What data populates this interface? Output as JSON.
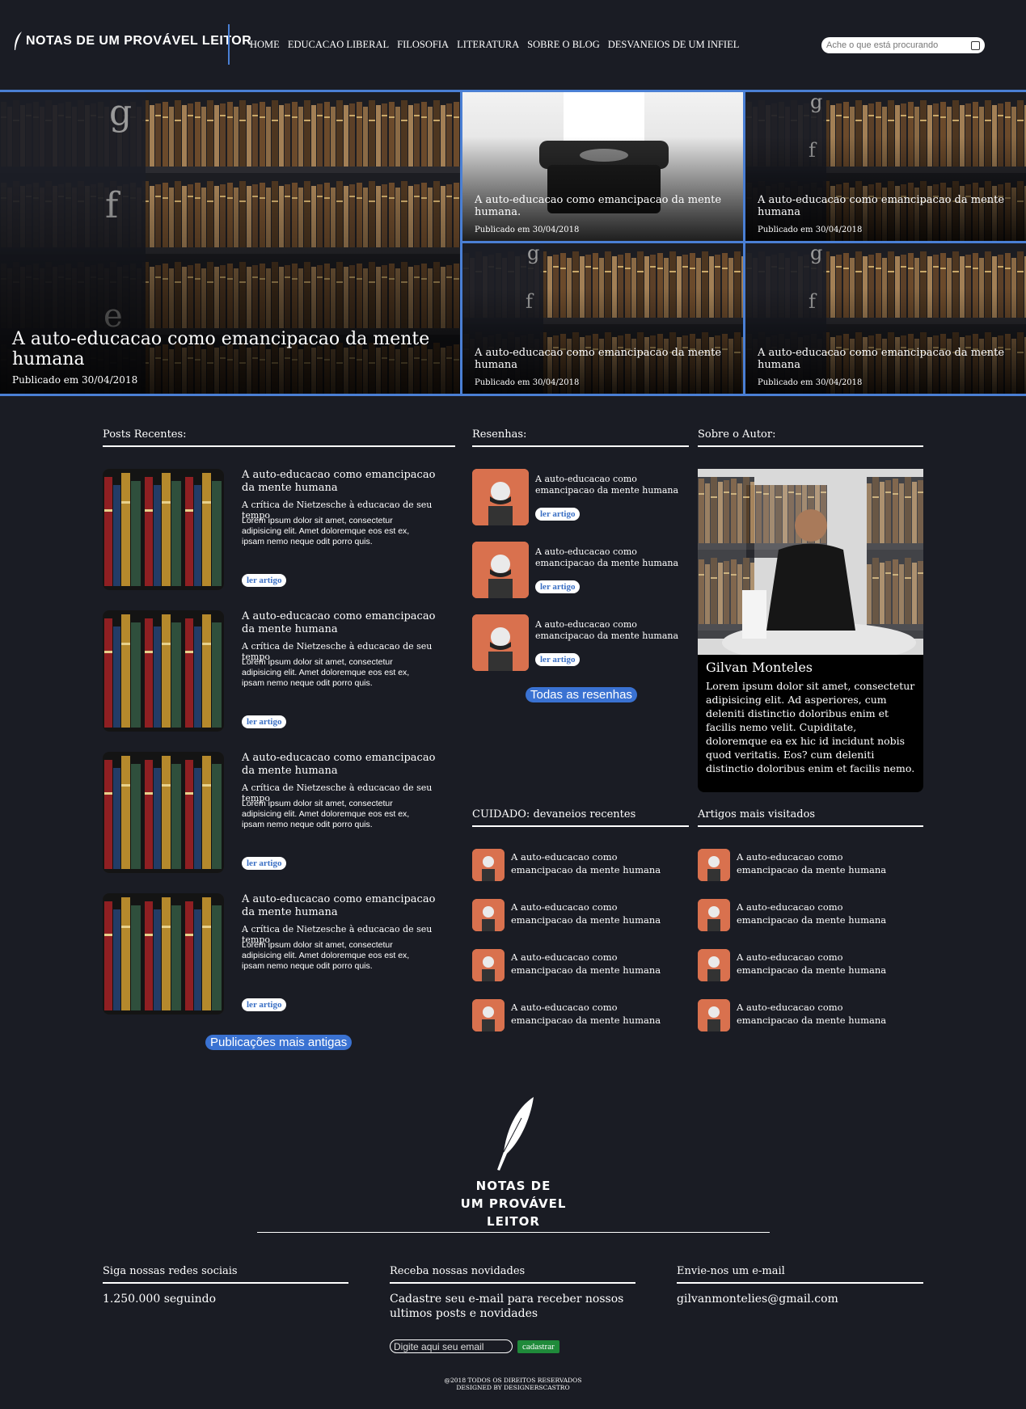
{
  "brand": {
    "logo_text": "NOTAS DE UM PROVÁVEL LEITOR"
  },
  "nav": [
    "HOME",
    "EDUCACAO LIBERAL",
    "FILOSOFIA",
    "LITERATURA",
    "SOBRE O BLOG",
    "DESVANEIOS DE UM INFIEL"
  ],
  "search": {
    "placeholder": "Ache o que está procurando"
  },
  "hero": {
    "main": {
      "title": "A auto-educacao como emancipacao da mente humana",
      "date": "Publicado em 30/04/2018"
    },
    "tiles": [
      {
        "title": "A auto-educacao como emancipacao da mente humana.",
        "date": "Publicado em 30/04/2018"
      },
      {
        "title": "A auto-educacao como emancipacao da mente humana",
        "date": "Publicado em 30/04/2018"
      },
      {
        "title": "A auto-educacao como emancipacao da mente humana",
        "date": "Publicado em 30/04/2018"
      },
      {
        "title": "A auto-educacao como emancipacao da mente humana",
        "date": "Publicado em 30/04/2018"
      }
    ]
  },
  "recent": {
    "heading": "Posts Recentes:",
    "posts": [
      {
        "title": "A auto-educacao como emancipacao da mente humana",
        "subtitle": "A crítica de Nietzesche à educacao de seu tempo",
        "excerpt": "Lorem ipsum dolor sit amet, consectetur adipisicing elit. Amet doloremque eos est ex, ipsam nemo neque odit porro quis.",
        "button": "ler artigo"
      },
      {
        "title": "A auto-educacao como emancipacao da mente humana",
        "subtitle": "A crítica de Nietzesche à educacao de seu tempo",
        "excerpt": "Lorem ipsum dolor sit amet, consectetur adipisicing elit. Amet doloremque eos est ex, ipsam nemo neque odit porro quis.",
        "button": "ler artigo"
      },
      {
        "title": "A auto-educacao como emancipacao da mente humana",
        "subtitle": "A crítica de Nietzesche à educacao de seu tempo",
        "excerpt": "Lorem ipsum dolor sit amet, consectetur adipisicing elit. Amet doloremque eos est ex, ipsam nemo neque odit porro quis.",
        "button": "ler artigo"
      },
      {
        "title": "A auto-educacao como emancipacao da mente humana",
        "subtitle": "A crítica de Nietzesche à educacao de seu tempo",
        "excerpt": "Lorem ipsum dolor sit amet, consectetur adipisicing elit. Amet doloremque eos est ex, ipsam nemo neque odit porro quis.",
        "button": "ler artigo"
      }
    ],
    "older_button": "Publicações mais antigas"
  },
  "reviews": {
    "heading": "Resenhas:",
    "items": [
      {
        "title": "A auto-educacao como emancipacao da mente humana",
        "button": "ler artigo"
      },
      {
        "title": "A auto-educacao como emancipacao da mente humana",
        "button": "ler artigo"
      },
      {
        "title": "A auto-educacao como emancipacao da mente humana",
        "button": "ler artigo"
      }
    ],
    "all_button": "Todas as resenhas"
  },
  "author": {
    "heading": "Sobre o Autor:",
    "name": "Gilvan Monteles",
    "bio": "Lorem ipsum dolor sit amet, consectetur adipisicing elit. Ad asperiores, cum deleniti distinctio doloribus enim et facilis nemo velit. Cupiditate, doloremque ea ex hic id incidunt nobis quod veritatis. Eos? cum deleniti distinctio doloribus enim et facilis nemo."
  },
  "caution": {
    "heading": "CUIDADO: devaneios recentes",
    "items": [
      "A auto-educacao como emancipacao da mente humana",
      "A auto-educacao como emancipacao da mente humana",
      "A auto-educacao como emancipacao da mente humana",
      "A auto-educacao como emancipacao da mente humana"
    ]
  },
  "visited": {
    "heading": "Artigos mais visitados",
    "items": [
      "A auto-educacao como emancipacao da mente humana",
      "A auto-educacao como emancipacao da mente humana",
      "A auto-educacao como emancipacao da mente humana",
      "A auto-educacao como emancipacao da mente humana"
    ]
  },
  "footer": {
    "logo_lines": [
      "NOTAS DE",
      "UM PROVÁVEL",
      "LEITOR"
    ],
    "social": {
      "heading": "Siga nossas redes sociais",
      "followers": "1.250.000 seguindo"
    },
    "newsletter": {
      "heading": "Receba nossas novidades",
      "text": "Cadastre seu e-mail para receber nossos ultimos posts e novidades",
      "placeholder": "Digite aqui seu email",
      "button": "cadastrar"
    },
    "contact": {
      "heading": "Envie-nos um e-mail",
      "email": "gilvanmontelies@gmail.com"
    },
    "copyright_line1": "@2018 TODOS OS DIREITOS RESERVADOS",
    "copyright_line2": "DESIGNED BY DESIGNERSCASTRO"
  },
  "colors": {
    "background": "#1a1c24",
    "accent": "#4a7fd4",
    "button_blue": "#3a72d2",
    "newsletter_green": "#1f8a3a",
    "review_thumb": "#d9714e"
  }
}
